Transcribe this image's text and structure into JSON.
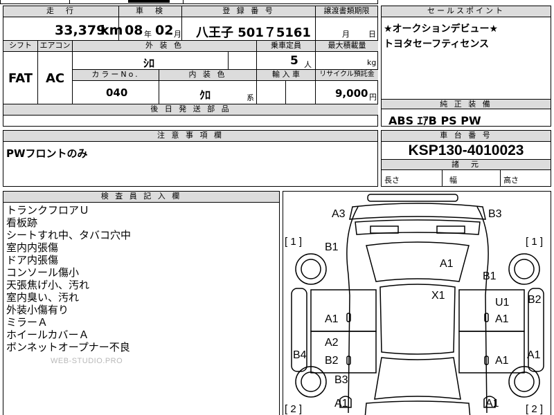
{
  "top_partial": "",
  "sheet": {
    "mileage_header": "走　行",
    "mileage_value": "33,379",
    "mileage_unit": "km",
    "shaken_header": "車　検",
    "shaken_year": "08",
    "shaken_year_unit": "年",
    "shaken_month": "02",
    "shaken_month_unit": "月",
    "registration_header": "登 録 番 号",
    "registration_value": "八王子 501７5161",
    "transfer_header": "譲渡書類期限",
    "transfer_month_unit": "月",
    "transfer_day_unit": "日",
    "shift_header": "シフト",
    "shift_value": "FAT",
    "aircon_header": "エアコン",
    "aircon_value": "AC",
    "exterior_color_header": "外 装 色",
    "exterior_color_value": "ｼﾛ",
    "capacity_header": "乗車定員",
    "capacity_value": "5",
    "capacity_unit": "人",
    "max_load_header": "最大積載量",
    "max_load_unit": "kg",
    "color_no_header": "カラーNo.",
    "color_no_value": "040",
    "interior_color_header": "内 装 色",
    "interior_color_value": "ｸﾛ",
    "interior_color_unit": "系",
    "import_header": "輸 入 車",
    "recycle_header": "リサイクル預託金",
    "recycle_value": "9,000",
    "recycle_unit": "円",
    "later_parts_header": "後 日 発 送 部 品"
  },
  "sales_points": {
    "header": "セールスポイント",
    "lines": [
      "★オークションデビュー★",
      "トヨタセーフティセンス"
    ]
  },
  "genuine_equipment": {
    "header": "純 正 装 備",
    "value": "ABS ｴｱB PS PW"
  },
  "notes": {
    "header": "注 意 事 項 欄",
    "value": "PWフロントのみ"
  },
  "chassis": {
    "header": "車 台 番 号",
    "value": "KSP130-4010023",
    "dimensions_header": "諸　元",
    "length_label": "長さ",
    "width_label": "幅",
    "height_label": "高さ"
  },
  "inspector": {
    "header": "検 査 員 記 入 欄",
    "lines": [
      "トランクフロアＵ",
      "看板跡",
      "シートすれ中、タバコ穴中",
      "室内内張傷",
      "ドア内張傷",
      "コンソール傷小",
      "天張焦げ小、汚れ",
      "室内臭い、汚れ",
      "外装小傷有り",
      "ミラーＡ",
      "ホイールカバーＡ",
      "ボンネットオープナー不良"
    ],
    "watermark": "WEB-STUDIO.PRO"
  },
  "diagram": {
    "marks": [
      {
        "id": "a3-top-left",
        "text": "A3"
      },
      {
        "id": "b3-top-right",
        "text": "B3"
      },
      {
        "id": "bracket-1-left",
        "text": "[ 1 ]"
      },
      {
        "id": "bracket-1-right",
        "text": "[ 1 ]"
      },
      {
        "id": "b1-left-rear",
        "text": "B1"
      },
      {
        "id": "a1-rear-window",
        "text": "A1"
      },
      {
        "id": "b1-right-rear",
        "text": "B1"
      },
      {
        "id": "x1-roof",
        "text": "X1"
      },
      {
        "id": "u1-right",
        "text": "U1"
      },
      {
        "id": "b2-right-edge",
        "text": "B2"
      },
      {
        "id": "a1-left-rear-door",
        "text": "A1"
      },
      {
        "id": "a1-right-rear-door",
        "text": "A1"
      },
      {
        "id": "a2-left-front-door",
        "text": "A2"
      },
      {
        "id": "b2-left-front-door",
        "text": "B2"
      },
      {
        "id": "b4-left-edge",
        "text": "B4"
      },
      {
        "id": "a1-right-front-door",
        "text": "A1"
      },
      {
        "id": "a1-right-edge",
        "text": "A1"
      },
      {
        "id": "b3-left-front",
        "text": "B3"
      },
      {
        "id": "a1-left-front-fender",
        "text": "A1"
      },
      {
        "id": "a1-right-front-fender",
        "text": "A1"
      },
      {
        "id": "bracket-2-left",
        "text": "[ 2 ]"
      },
      {
        "id": "bracket-2-right",
        "text": "[ 2 ]"
      }
    ]
  }
}
